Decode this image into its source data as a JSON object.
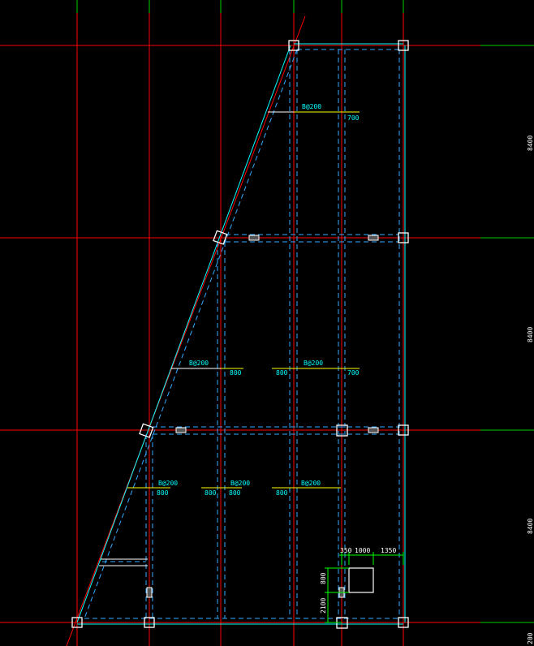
{
  "colors": {
    "background": "#000000",
    "grid_axis": "#ff0000",
    "beam_line": "#00ffff",
    "slab_edge": "#33aaff",
    "rebar_line": "#ffff00",
    "column": "#ffffff",
    "edge_tick": "#00cc00",
    "dimension": "#00ff00"
  },
  "rebar_labels": [
    {
      "text": "B@200",
      "span": "700"
    },
    {
      "text": "B@200",
      "span": "800"
    },
    {
      "text": "B@200",
      "left": "800",
      "span": "700"
    },
    {
      "text": "B@200",
      "span": "800"
    },
    {
      "text": "B@200",
      "left": "800",
      "span": "800"
    },
    {
      "text": "B@200",
      "left": "800"
    }
  ],
  "dimensions": {
    "top_dims": [
      "350",
      "1000",
      "1350"
    ],
    "side_dims": [
      "800",
      "2100"
    ]
  },
  "side_dims_right": [
    "8400",
    "8400",
    "8400",
    "200"
  ]
}
